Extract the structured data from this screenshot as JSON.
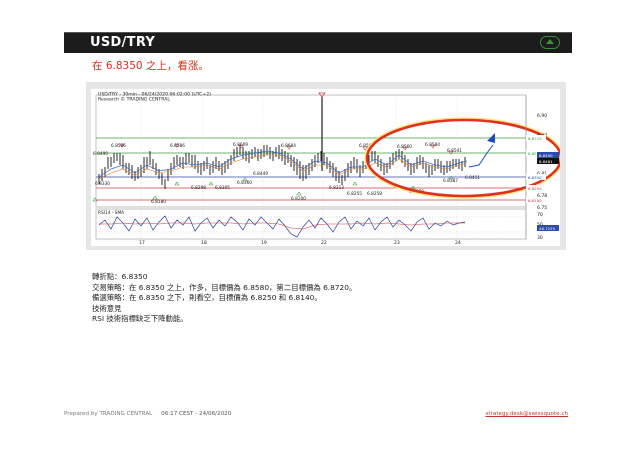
{
  "header": {
    "title": "USD/TRY"
  },
  "headline": "在  6.8350 之上，看涨。",
  "chart": {
    "title_line1": "USD/TRY - 30min - 06/24/2020 06:02:00 (UTC+2)",
    "title_line2": "Research © TRADING CENTRAL",
    "rsi_label": "RSI14 - SMA",
    "price_axis": [
      "6.90",
      "6.87",
      "6.84",
      "6.81",
      "6.78",
      "6.75"
    ],
    "rsi_axis": [
      "70",
      "50",
      "30"
    ],
    "level_tags": [
      "6.8720",
      "6.8580",
      "6.8490",
      "6.8461",
      "6.8350",
      "6.8250",
      "6.8140"
    ],
    "rsi_tag": "46.7255",
    "date_labels": [
      "17",
      "18",
      "19",
      "22",
      "23",
      "24"
    ],
    "marker_labels_top": [
      "6.8586",
      "6.8586",
      "6.8609",
      "6.8684",
      "6.8565",
      "6.8560",
      "6.8584",
      "6.8541",
      "6.8490"
    ],
    "marker_labels_bottom": [
      "6.8180",
      "6.8298",
      "6.8305",
      "6.8360",
      "6.8449",
      "6.8200",
      "6.8313",
      "6.8255",
      "6.8258",
      "6.8270",
      "6.8387",
      "6.8411",
      "6.8330"
    ],
    "colors": {
      "resistance": "#3aa03a",
      "support": "#d23b3b",
      "pivot": "#2c4aa8",
      "annotation": "#e03020",
      "arrow": "#1f4fb3"
    }
  },
  "notes": {
    "pivot": "轉折點：6.8350",
    "strategy": "交易策略：在 6.8350 之上，作多，目標價為  6.8580，第二目標價為 6.8720。",
    "alternative": "備選策略：在 6.8350 之下，則看空，目標價為  6.8250 和 6.8140。",
    "comment_title": "技術意見",
    "comment": "RSI 技術指標缺乏下降動能。"
  },
  "footer": {
    "prepared": "Prepared by TRADING CENTRAL",
    "timestamp": "06:17 CEST - 24/06/2020",
    "email": "strategy.desk@swissquote.ch"
  }
}
